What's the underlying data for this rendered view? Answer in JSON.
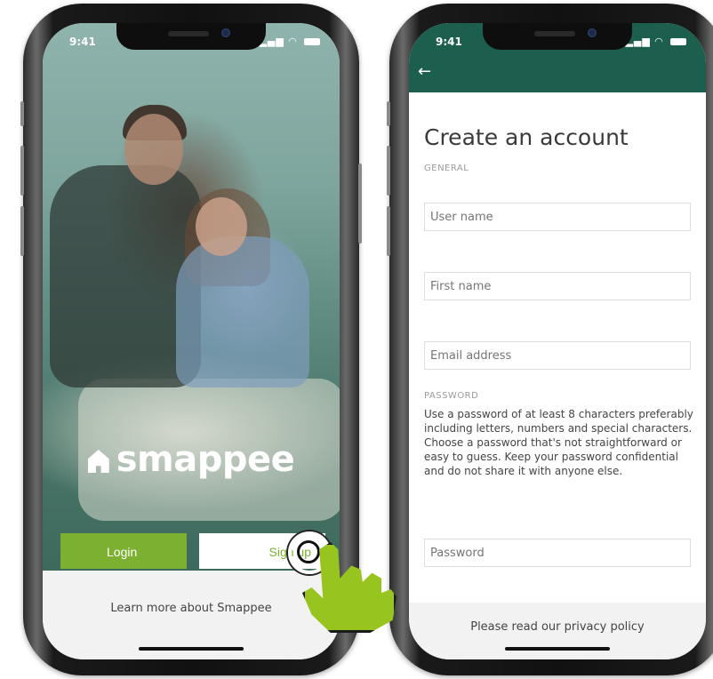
{
  "phone_left": {
    "status": {
      "time": "9:41",
      "signal": "▂▄▆",
      "wifi": "wifi-icon",
      "battery": "battery-icon"
    },
    "logo_text": "smappee",
    "login_label": "Login",
    "signup_label": "Sign up",
    "learn_more": "Learn more about Smappee"
  },
  "phone_right": {
    "status": {
      "time": "9:41",
      "signal": "▂▄▆",
      "wifi": "wifi-icon",
      "battery": "battery-icon"
    },
    "back_icon": "←",
    "title": "Create an account",
    "section_general": "GENERAL",
    "fields": {
      "username_placeholder": "User name",
      "firstname_placeholder": "First name",
      "email_placeholder": "Email address",
      "password_placeholder": "Password"
    },
    "section_password": "PASSWORD",
    "password_help": "Use a password of at least 8 characters preferably including letters, numbers and special characters. Choose a password that's not straightforward or easy to guess. Keep your password confidential and do not share it with anyone else.",
    "privacy": "Please read our privacy policy"
  },
  "colors": {
    "brand_green": "#7bb030",
    "header_teal": "#1d5f4f",
    "cursor_green": "#97c41f"
  }
}
